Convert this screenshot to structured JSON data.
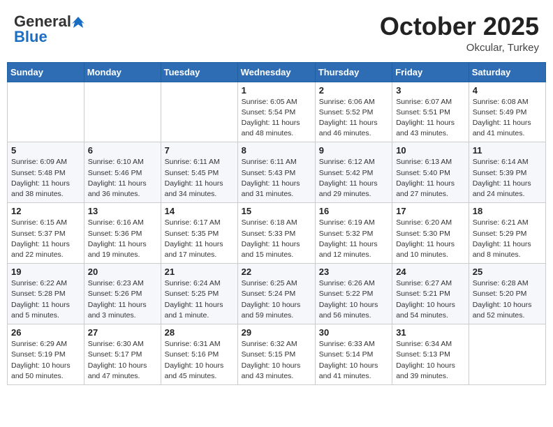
{
  "header": {
    "logo_general": "General",
    "logo_blue": "Blue",
    "month_title": "October 2025",
    "location": "Okcular, Turkey"
  },
  "weekdays": [
    "Sunday",
    "Monday",
    "Tuesday",
    "Wednesday",
    "Thursday",
    "Friday",
    "Saturday"
  ],
  "weeks": [
    [
      {
        "day": "",
        "info": ""
      },
      {
        "day": "",
        "info": ""
      },
      {
        "day": "",
        "info": ""
      },
      {
        "day": "1",
        "info": "Sunrise: 6:05 AM\nSunset: 5:54 PM\nDaylight: 11 hours\nand 48 minutes."
      },
      {
        "day": "2",
        "info": "Sunrise: 6:06 AM\nSunset: 5:52 PM\nDaylight: 11 hours\nand 46 minutes."
      },
      {
        "day": "3",
        "info": "Sunrise: 6:07 AM\nSunset: 5:51 PM\nDaylight: 11 hours\nand 43 minutes."
      },
      {
        "day": "4",
        "info": "Sunrise: 6:08 AM\nSunset: 5:49 PM\nDaylight: 11 hours\nand 41 minutes."
      }
    ],
    [
      {
        "day": "5",
        "info": "Sunrise: 6:09 AM\nSunset: 5:48 PM\nDaylight: 11 hours\nand 38 minutes."
      },
      {
        "day": "6",
        "info": "Sunrise: 6:10 AM\nSunset: 5:46 PM\nDaylight: 11 hours\nand 36 minutes."
      },
      {
        "day": "7",
        "info": "Sunrise: 6:11 AM\nSunset: 5:45 PM\nDaylight: 11 hours\nand 34 minutes."
      },
      {
        "day": "8",
        "info": "Sunrise: 6:11 AM\nSunset: 5:43 PM\nDaylight: 11 hours\nand 31 minutes."
      },
      {
        "day": "9",
        "info": "Sunrise: 6:12 AM\nSunset: 5:42 PM\nDaylight: 11 hours\nand 29 minutes."
      },
      {
        "day": "10",
        "info": "Sunrise: 6:13 AM\nSunset: 5:40 PM\nDaylight: 11 hours\nand 27 minutes."
      },
      {
        "day": "11",
        "info": "Sunrise: 6:14 AM\nSunset: 5:39 PM\nDaylight: 11 hours\nand 24 minutes."
      }
    ],
    [
      {
        "day": "12",
        "info": "Sunrise: 6:15 AM\nSunset: 5:37 PM\nDaylight: 11 hours\nand 22 minutes."
      },
      {
        "day": "13",
        "info": "Sunrise: 6:16 AM\nSunset: 5:36 PM\nDaylight: 11 hours\nand 19 minutes."
      },
      {
        "day": "14",
        "info": "Sunrise: 6:17 AM\nSunset: 5:35 PM\nDaylight: 11 hours\nand 17 minutes."
      },
      {
        "day": "15",
        "info": "Sunrise: 6:18 AM\nSunset: 5:33 PM\nDaylight: 11 hours\nand 15 minutes."
      },
      {
        "day": "16",
        "info": "Sunrise: 6:19 AM\nSunset: 5:32 PM\nDaylight: 11 hours\nand 12 minutes."
      },
      {
        "day": "17",
        "info": "Sunrise: 6:20 AM\nSunset: 5:30 PM\nDaylight: 11 hours\nand 10 minutes."
      },
      {
        "day": "18",
        "info": "Sunrise: 6:21 AM\nSunset: 5:29 PM\nDaylight: 11 hours\nand 8 minutes."
      }
    ],
    [
      {
        "day": "19",
        "info": "Sunrise: 6:22 AM\nSunset: 5:28 PM\nDaylight: 11 hours\nand 5 minutes."
      },
      {
        "day": "20",
        "info": "Sunrise: 6:23 AM\nSunset: 5:26 PM\nDaylight: 11 hours\nand 3 minutes."
      },
      {
        "day": "21",
        "info": "Sunrise: 6:24 AM\nSunset: 5:25 PM\nDaylight: 11 hours\nand 1 minute."
      },
      {
        "day": "22",
        "info": "Sunrise: 6:25 AM\nSunset: 5:24 PM\nDaylight: 10 hours\nand 59 minutes."
      },
      {
        "day": "23",
        "info": "Sunrise: 6:26 AM\nSunset: 5:22 PM\nDaylight: 10 hours\nand 56 minutes."
      },
      {
        "day": "24",
        "info": "Sunrise: 6:27 AM\nSunset: 5:21 PM\nDaylight: 10 hours\nand 54 minutes."
      },
      {
        "day": "25",
        "info": "Sunrise: 6:28 AM\nSunset: 5:20 PM\nDaylight: 10 hours\nand 52 minutes."
      }
    ],
    [
      {
        "day": "26",
        "info": "Sunrise: 6:29 AM\nSunset: 5:19 PM\nDaylight: 10 hours\nand 50 minutes."
      },
      {
        "day": "27",
        "info": "Sunrise: 6:30 AM\nSunset: 5:17 PM\nDaylight: 10 hours\nand 47 minutes."
      },
      {
        "day": "28",
        "info": "Sunrise: 6:31 AM\nSunset: 5:16 PM\nDaylight: 10 hours\nand 45 minutes."
      },
      {
        "day": "29",
        "info": "Sunrise: 6:32 AM\nSunset: 5:15 PM\nDaylight: 10 hours\nand 43 minutes."
      },
      {
        "day": "30",
        "info": "Sunrise: 6:33 AM\nSunset: 5:14 PM\nDaylight: 10 hours\nand 41 minutes."
      },
      {
        "day": "31",
        "info": "Sunrise: 6:34 AM\nSunset: 5:13 PM\nDaylight: 10 hours\nand 39 minutes."
      },
      {
        "day": "",
        "info": ""
      }
    ]
  ]
}
